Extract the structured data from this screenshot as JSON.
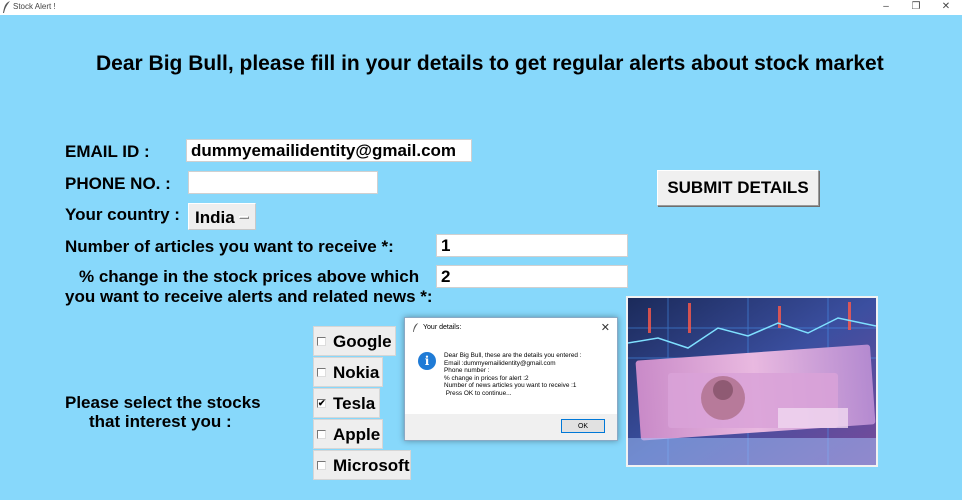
{
  "window": {
    "title": "Stock Alert !",
    "minimize": "–",
    "restore": "❐",
    "close": "✕"
  },
  "heading": "Dear Big Bull, please fill in your details to get regular alerts about stock market",
  "form": {
    "email_label": "EMAIL ID  :",
    "email_value": "dummyemailidentity@gmail.com",
    "phone_label": "PHONE NO. :",
    "phone_value": "",
    "country_label": "Your country :",
    "country_value": "India",
    "articles_label": "Number of articles you want to receive *:",
    "articles_value": "1",
    "change_label_line1": "% change in the stock prices above which",
    "change_label_line2": "you want to receive alerts and related news *:",
    "change_value": "2",
    "submit_label": "SUBMIT DETAILS",
    "stocks_label_line1": "Please select the stocks",
    "stocks_label_line2": "that interest you :"
  },
  "stocks": [
    {
      "name": "Google",
      "checked": false
    },
    {
      "name": "Nokia",
      "checked": false
    },
    {
      "name": "Tesla",
      "checked": true
    },
    {
      "name": "Apple",
      "checked": false
    },
    {
      "name": "Microsoft",
      "checked": false
    }
  ],
  "dialog": {
    "title": "Your details:",
    "close": "✕",
    "icon": "info-icon",
    "message": "Dear Big Bull, these are the details you entered :\nEmail :dummyemailidentity@gmail.com\nPhone number :\n% change in prices for alert :2\nNumber of news articles you want to receive :1\n Press OK to continue...",
    "ok_label": "OK"
  },
  "colors": {
    "background": "#87d8fb",
    "accent": "#0078d7"
  }
}
